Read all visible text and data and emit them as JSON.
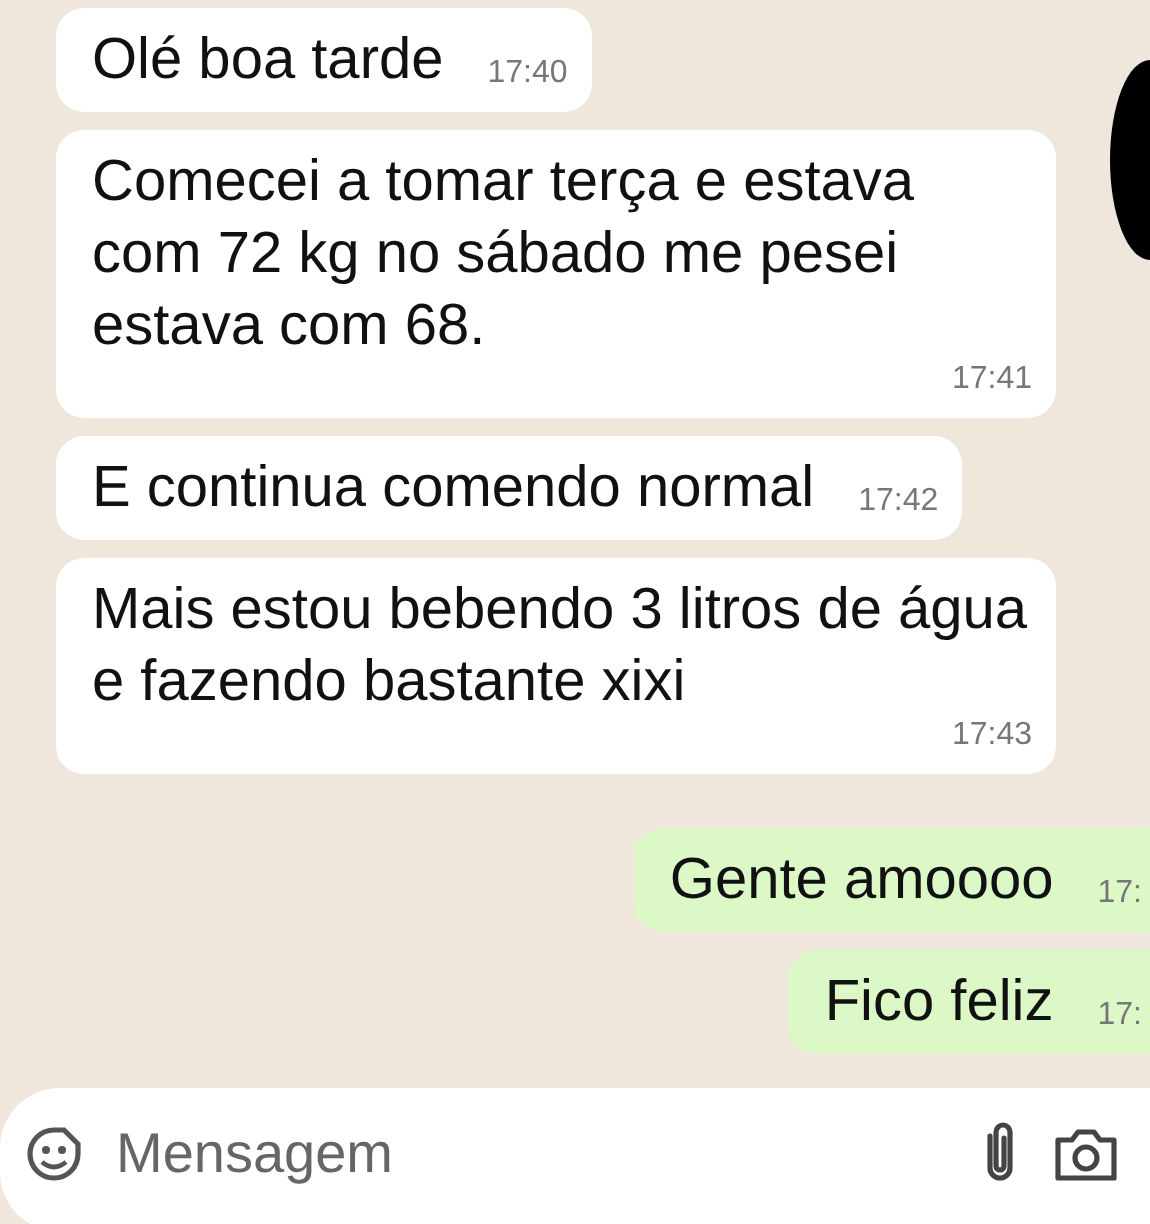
{
  "messages": [
    {
      "kind": "received",
      "text": "Olé boa tarde",
      "time": "17:40"
    },
    {
      "kind": "received",
      "text": "Comecei a tomar terça e estava com 72 kg no sábado me pesei estava com 68.",
      "time": "17:41"
    },
    {
      "kind": "received",
      "text": "E continua comendo normal",
      "time": "17:42"
    },
    {
      "kind": "received",
      "text": "Mais estou bebendo 3 litros de água e fazendo bastante xixi",
      "time": "17:43"
    },
    {
      "kind": "sent",
      "text": "Gente amoooo",
      "time": "17:"
    },
    {
      "kind": "sent",
      "text": "Fico feliz",
      "time": "17:"
    }
  ],
  "composer": {
    "placeholder": "Mensagem"
  }
}
